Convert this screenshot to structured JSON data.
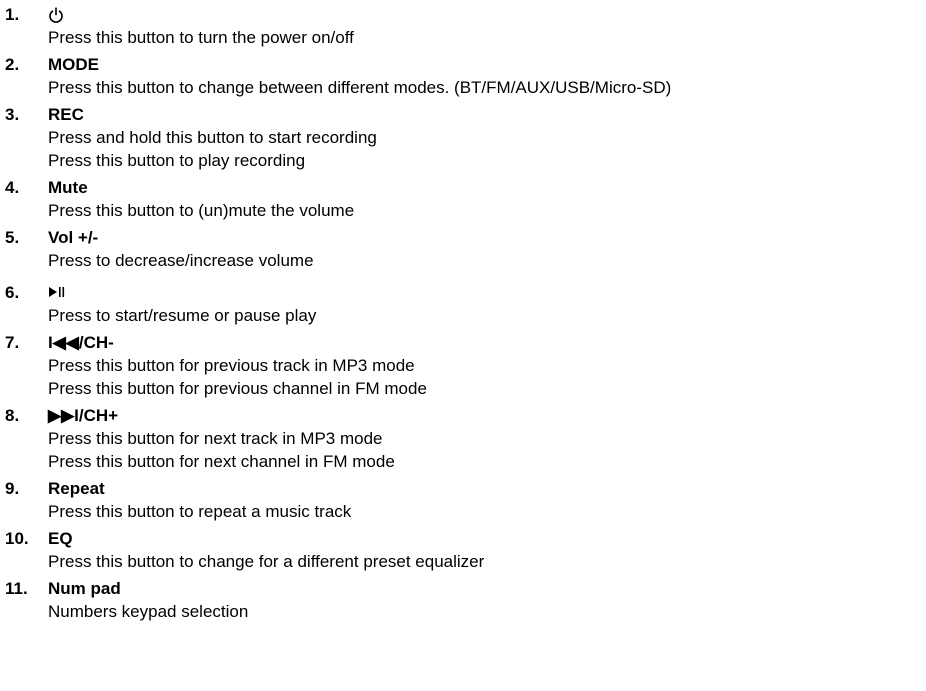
{
  "items": [
    {
      "number": "1.",
      "title": "",
      "icon": "power-icon",
      "lines": [
        "Press this button to turn the power on/off"
      ]
    },
    {
      "number": "2.",
      "title": "MODE",
      "lines": [
        "Press this button to change between different modes. (BT/FM/AUX/USB/Micro-SD)"
      ]
    },
    {
      "number": "3.",
      "title": "REC",
      "lines": [
        "Press and hold this button to start recording",
        "Press this button to play recording"
      ]
    },
    {
      "number": "4.",
      "title": "Mute",
      "lines": [
        "Press this button to (un)mute the volume"
      ]
    },
    {
      "number": "5.",
      "title": "Vol +/-",
      "lines": [
        "Press to decrease/increase volume"
      ]
    },
    {
      "number": "6.",
      "title": "",
      "icon": "play-pause-icon",
      "lines": [
        "Press to start/resume or pause play"
      ]
    },
    {
      "number": "7.",
      "title": "I◀◀/CH-",
      "lines": [
        "Press this button for previous track in MP3 mode",
        "Press this button for previous channel in FM mode"
      ]
    },
    {
      "number": "8.",
      "title": "▶▶I/CH+",
      "lines": [
        "Press this button for next track in MP3 mode",
        "Press this button for next channel in FM mode"
      ]
    },
    {
      "number": "9.",
      "title": "Repeat",
      "lines": [
        "Press this button to repeat a music track"
      ]
    },
    {
      "number": "10.",
      "title": "EQ",
      "lines": [
        "Press this button to change for a different preset equalizer"
      ]
    },
    {
      "number": "11.",
      "title": "Num pad",
      "lines": [
        "Numbers keypad selection"
      ]
    }
  ]
}
